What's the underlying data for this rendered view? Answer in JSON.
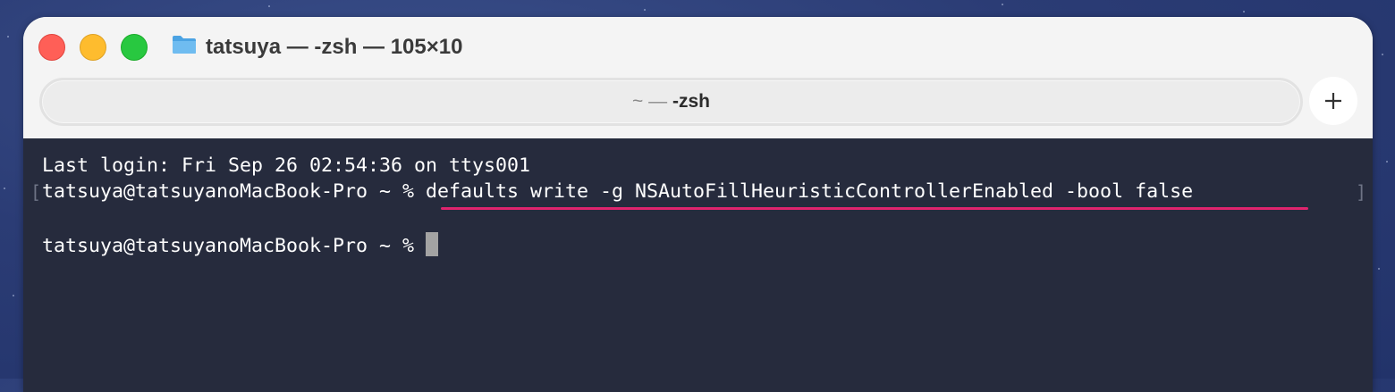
{
  "window": {
    "title": "tatsuya — -zsh — 105×10"
  },
  "tab": {
    "dim_prefix": "~ —",
    "label": "-zsh",
    "new_tab_label": "+"
  },
  "terminal": {
    "last_login": "Last login: Fri Sep 26 02:54:36 on ttys001",
    "prompt": "tatsuya@tatsuyanoMacBook-Pro ~ % ",
    "command": "defaults write -g NSAutoFillHeuristicControllerEnabled -bool false",
    "prompt2": "tatsuya@tatsuyanoMacBook-Pro ~ % ",
    "bracket_open": "[",
    "bracket_close": "]"
  },
  "colors": {
    "terminal_bg": "#262b3d",
    "underline": "#e0246e",
    "close": "#ff5f57",
    "minimize": "#febc2e",
    "zoom": "#28c840"
  },
  "icons": {
    "folder": "folder-icon",
    "plus": "plus-icon"
  }
}
